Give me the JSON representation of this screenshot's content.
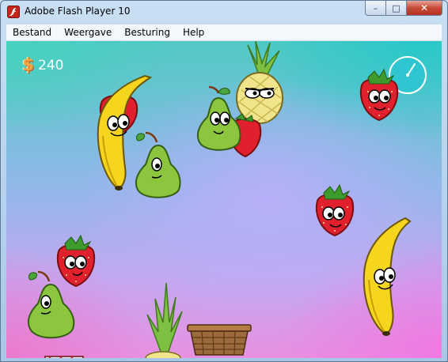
{
  "window": {
    "title": "Adobe Flash Player 10",
    "icon": "flash-player-icon",
    "controls": {
      "minimize": "–",
      "maximize": "□",
      "close": "✕"
    }
  },
  "menu": {
    "items": [
      "Bestand",
      "Weergave",
      "Besturing",
      "Help"
    ]
  },
  "hud": {
    "money_icon": "dollar-coin-icon",
    "money_symbol": "$",
    "money_value": "240",
    "timer_icon": "clock-timer-icon"
  },
  "colors": {
    "stage_teal": "#52c9c5",
    "stage_violet": "#c4a8f0",
    "stage_pink": "#e890e0",
    "banana": "#f6d51f",
    "pear": "#8cc63f",
    "strawberry": "#e0202c",
    "pineapple": "#f1e58c",
    "basket": "#9c6b3c"
  },
  "game": {
    "objects": [
      "banana",
      "strawberry",
      "pear",
      "pineapple",
      "pear",
      "strawberry",
      "strawberry",
      "strawberry",
      "pear",
      "banana",
      "pineapple-top",
      "basket",
      "trap"
    ]
  }
}
